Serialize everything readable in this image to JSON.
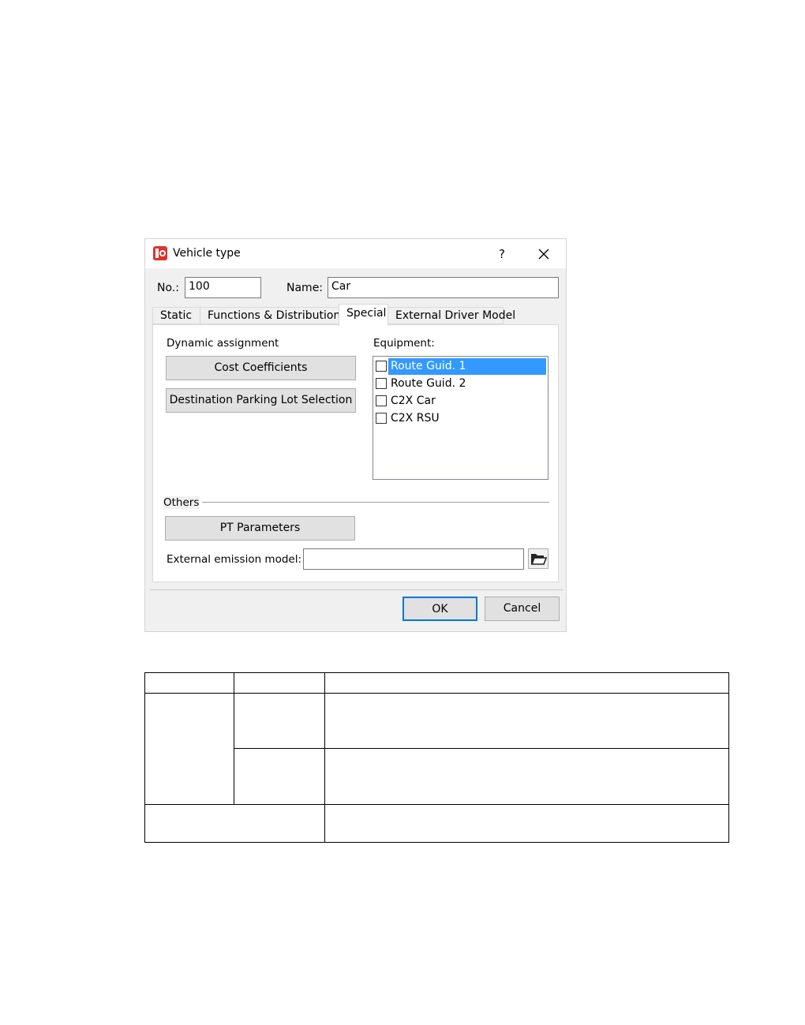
{
  "dialog": {
    "title": "Vehicle type",
    "help_label": "?",
    "no_label": "No.:",
    "no_value": "100",
    "name_label": "Name:",
    "name_value": "Car"
  },
  "tabs": [
    {
      "label": "Static"
    },
    {
      "label": "Functions & Distributions"
    },
    {
      "label": "Special"
    },
    {
      "label": "External Driver Model"
    }
  ],
  "special": {
    "dynamic_assignment_label": "Dynamic assignment",
    "cost_coefficients_label": "Cost Coefficients",
    "destination_parking_label": "Destination Parking Lot Selection",
    "equipment_label": "Equipment:",
    "equipment_items": [
      {
        "label": "Route Guid. 1",
        "checked": false,
        "selected": true
      },
      {
        "label": "Route Guid. 2",
        "checked": false,
        "selected": false
      },
      {
        "label": "C2X Car",
        "checked": false,
        "selected": false
      },
      {
        "label": "C2X RSU",
        "checked": false,
        "selected": false
      }
    ],
    "others_label": "Others",
    "pt_parameters_label": "PT Parameters",
    "external_emission_label": "External emission model:",
    "external_emission_value": ""
  },
  "footer": {
    "ok_label": "OK",
    "cancel_label": "Cancel"
  },
  "colors": {
    "selection": "#3399ff",
    "default_button_border": "#0078d7",
    "app_icon": "#e0322d"
  }
}
